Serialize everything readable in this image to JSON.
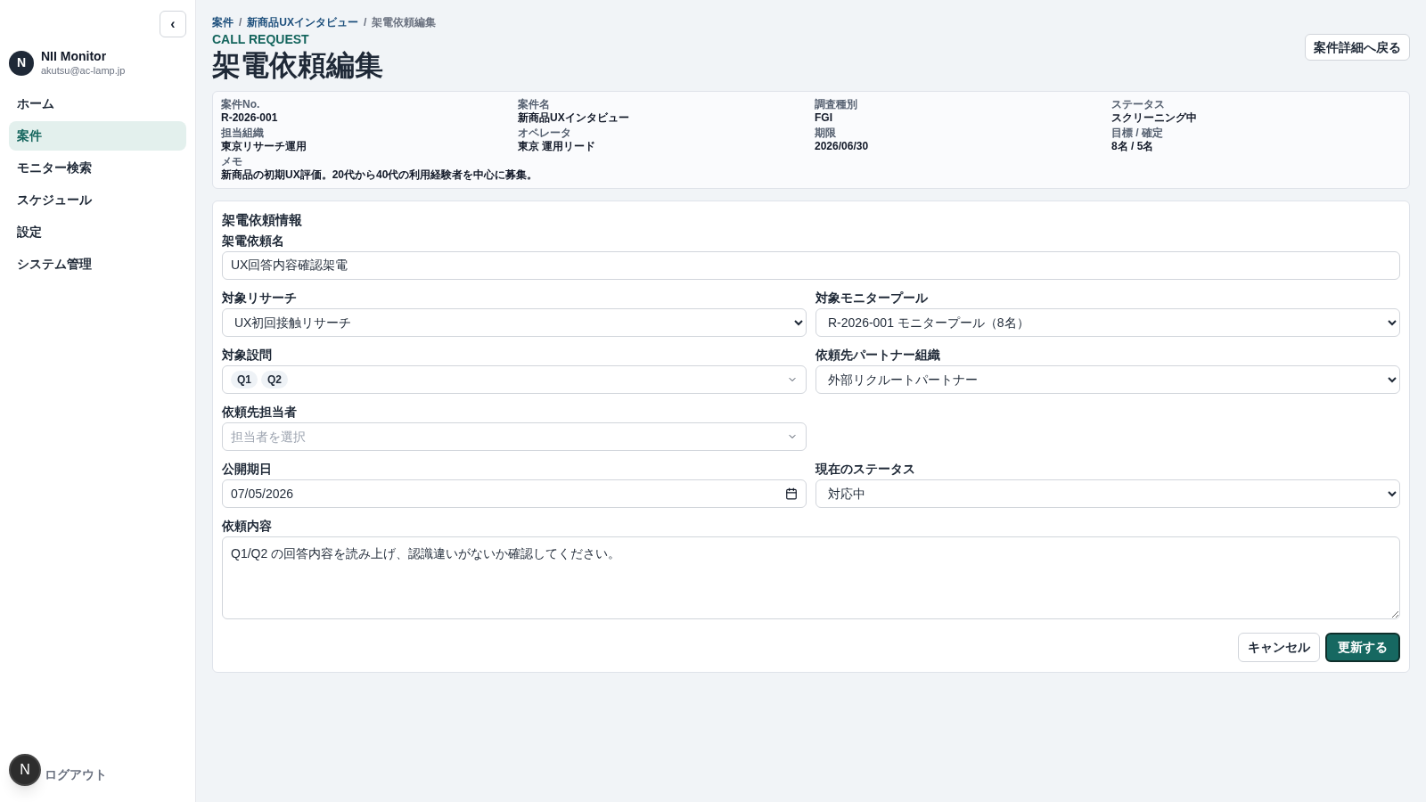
{
  "sidebar": {
    "collapse_label": "‹",
    "user": {
      "initial": "N",
      "name": "NII Monitor",
      "email": "akutsu@ac-lamp.jp"
    },
    "items": [
      {
        "label": "ホーム",
        "selected": false
      },
      {
        "label": "案件",
        "selected": true
      },
      {
        "label": "モニター検索",
        "selected": false
      },
      {
        "label": "スケジュール",
        "selected": false
      },
      {
        "label": "設定",
        "selected": false
      },
      {
        "label": "システム管理",
        "selected": false
      }
    ],
    "logout": "ログアウト",
    "floating_initial": "N"
  },
  "breadcrumb": {
    "separator": "/",
    "items": [
      {
        "label": "案件",
        "current": false
      },
      {
        "label": "新商品UXインタビュー",
        "current": false
      },
      {
        "label": "架電依頼編集",
        "current": true
      }
    ]
  },
  "eyebrow": "CALL REQUEST",
  "title": "架電依頼編集",
  "back_button": "案件詳細へ戻る",
  "summary": [
    {
      "label": "案件No.",
      "value": "R-2026-001"
    },
    {
      "label": "案件名",
      "value": "新商品UXインタビュー"
    },
    {
      "label": "調査種別",
      "value": "FGI"
    },
    {
      "label": "ステータス",
      "value": "スクリーニング中"
    },
    {
      "label": "担当組織",
      "value": "東京リサーチ運用"
    },
    {
      "label": "オペレータ",
      "value": "東京 運用リード"
    },
    {
      "label": "期限",
      "value": "2026/06/30"
    },
    {
      "label": "目標 / 確定",
      "value": "8名 / 5名"
    }
  ],
  "memo": {
    "label": "メモ",
    "value": "新商品の初期UX評価。20代から40代の利用経験者を中心に募集。"
  },
  "form": {
    "title": "架電依頼情報",
    "fields": [
      {
        "kind": "text",
        "label": "架電依頼名",
        "value": "UX回答内容確認架電"
      },
      {
        "kind": "select",
        "label": "対象リサーチ",
        "value": "UX初回接触リサーチ"
      },
      {
        "kind": "select",
        "label": "対象モニタープール",
        "value": "R-2026-001 モニタープール（8名）"
      },
      {
        "kind": "chips",
        "label": "対象設問",
        "chips": [
          "Q1",
          "Q2"
        ]
      },
      {
        "kind": "select",
        "label": "依頼先パートナー組織",
        "value": "外部リクルートパートナー"
      },
      {
        "kind": "combo",
        "label": "依頼先担当者",
        "placeholder": "担当者を選択"
      },
      {
        "kind": "empty"
      },
      {
        "kind": "date",
        "label": "公開期日",
        "value": "07/05/2026"
      },
      {
        "kind": "select",
        "label": "現在のステータス",
        "value": "対応中"
      },
      {
        "kind": "textarea",
        "label": "依頼内容",
        "value": "Q1/Q2 の回答内容を読み上げ、認識違いがないか確認してください。"
      }
    ],
    "cancel": "キャンセル",
    "submit": "更新する"
  }
}
